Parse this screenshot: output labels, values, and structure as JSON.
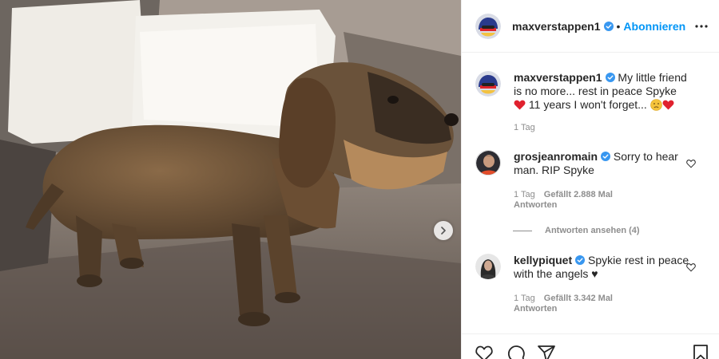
{
  "post": {
    "username": "maxverstappen1",
    "separator": "•",
    "follow_label": "Abonnieren"
  },
  "caption": {
    "username": "maxverstappen1",
    "text_1": "My little friend is no more... rest in peace Spyke ",
    "text_2": " 11 years I won't forget... ",
    "time": "1 Tag"
  },
  "comments": [
    {
      "username": "grosjeanromain",
      "text": "Sorry to hear man. RIP Spyke",
      "time": "1 Tag",
      "likes": "Gefällt 2.888 Mal",
      "reply": "Antworten",
      "view_replies": "Antworten ansehen (4)"
    },
    {
      "username": "kellypiquet",
      "text": "Spykie rest in peace with the angels ♥",
      "time": "1 Tag",
      "likes": "Gefällt 3.342 Mal",
      "reply": "Antworten"
    }
  ],
  "icons": {
    "verified": "verified-badge-icon",
    "more": "more-options-icon",
    "next": "chevron-right-icon",
    "like": "heart-icon",
    "comment": "comment-icon",
    "share": "paper-plane-icon",
    "save": "bookmark-icon"
  },
  "colors": {
    "accent": "#0095f6",
    "verified": "#3897f0",
    "heart_red": "#ed4956",
    "muted": "#8e8e8e",
    "border": "#efefef"
  }
}
